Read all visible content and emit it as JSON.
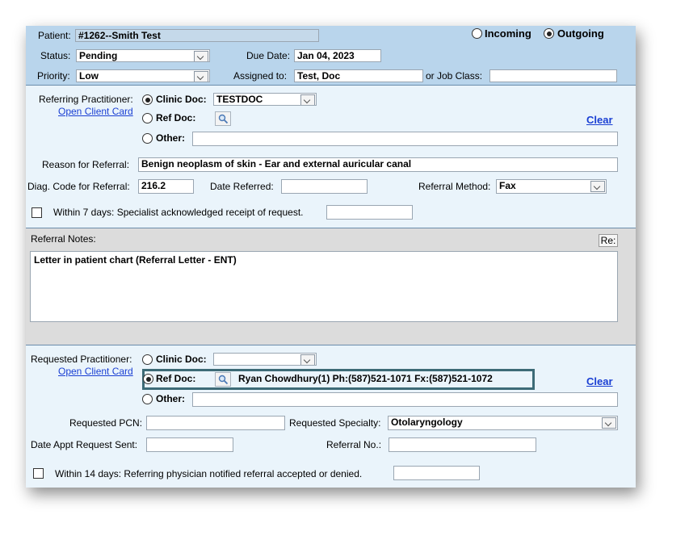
{
  "header": {
    "patient_label": "Patient:",
    "patient_value": "#1262--Smith Test",
    "direction": {
      "incoming_label": "Incoming",
      "outgoing_label": "Outgoing",
      "selected": "Outgoing"
    },
    "status_label": "Status:",
    "status_value": "Pending",
    "due_date_label": "Due Date:",
    "due_date_value": "Jan 04, 2023",
    "priority_label": "Priority:",
    "priority_value": "Low",
    "assigned_to_label": "Assigned to:",
    "assigned_to_value": "Test, Doc",
    "job_class_label": "or Job Class:",
    "job_class_value": ""
  },
  "referring": {
    "label": "Referring Practitioner:",
    "open_client_card": "Open Client Card",
    "clinic_doc_label": "Clinic Doc:",
    "clinic_doc_value": "TESTDOC",
    "ref_doc_label": "Ref Doc:",
    "other_label": "Other:",
    "other_value": "",
    "selected": "Clinic Doc",
    "clear_label": "Clear",
    "reason_label": "Reason for Referral:",
    "reason_value": "Benign neoplasm of skin - Ear and external auricular canal",
    "diag_code_label": "Diag. Code for Referral:",
    "diag_code_value": "216.2",
    "date_referred_label": "Date Referred:",
    "date_referred_value": "",
    "referral_method_label": "Referral Method:",
    "referral_method_value": "Fax",
    "within7_label": "Within 7 days: Specialist acknowledged receipt of request.",
    "within7_checked": false,
    "within7_value": ""
  },
  "notes": {
    "label": "Referral Notes:",
    "re_button": "Re:",
    "text": "Letter in patient chart (Referral Letter - ENT)"
  },
  "requested": {
    "label": "Requested Practitioner:",
    "open_client_card": "Open Client Card",
    "clinic_doc_label": "Clinic Doc:",
    "clinic_doc_value": "",
    "ref_doc_label": "Ref Doc:",
    "ref_doc_value": "Ryan Chowdhury(1) Ph:(587)521-1071 Fx:(587)521-1072",
    "other_label": "Other:",
    "other_value": "",
    "selected": "Ref Doc",
    "clear_label": "Clear",
    "pcn_label": "Requested PCN:",
    "pcn_value": "",
    "specialty_label": "Requested Specialty:",
    "specialty_value": "Otolaryngology",
    "appt_sent_label": "Date Appt Request Sent:",
    "appt_sent_value": "",
    "referral_no_label": "Referral No.:",
    "referral_no_value": "",
    "within14_label": "Within 14 days: Referring physician notified referral accepted or denied.",
    "within14_checked": false,
    "within14_value": ""
  },
  "colors": {
    "header_bg": "#b9d5ec",
    "section_bg": "#eaf4fb",
    "notes_bg": "#dcdcdc",
    "link": "#1a3fd3",
    "highlight": "#3d6b77"
  }
}
